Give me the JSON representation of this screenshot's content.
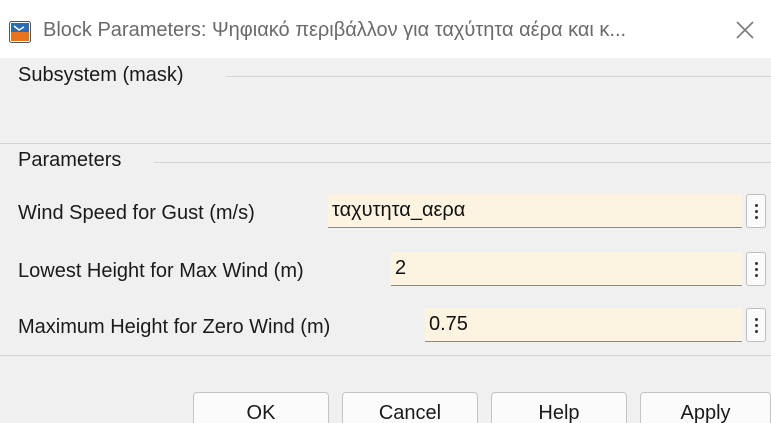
{
  "window": {
    "title": "Block Parameters: Ψηφιακό περιβάλλον για ταχύτητα αέρα και κ...",
    "app_icon": "simulink-block-icon",
    "close_icon": "close-icon"
  },
  "sections": {
    "subsystem_header": "Subsystem (mask)",
    "parameters_header": "Parameters"
  },
  "parameters": [
    {
      "label": "Wind Speed for Gust (m/s)",
      "value": "ταχυτητα_αερα"
    },
    {
      "label": "Lowest Height for Max Wind (m)",
      "value": "2"
    },
    {
      "label": "Maximum Height for Zero Wind (m)",
      "value": "0.75"
    }
  ],
  "buttons": {
    "ok": "OK",
    "cancel": "Cancel",
    "help": "Help",
    "apply": "Apply"
  },
  "colors": {
    "field_background": "#fdf3e1",
    "dialog_background": "#f0f0f0",
    "icon_blue": "#2b6cb0",
    "icon_orange": "#e8731c"
  }
}
